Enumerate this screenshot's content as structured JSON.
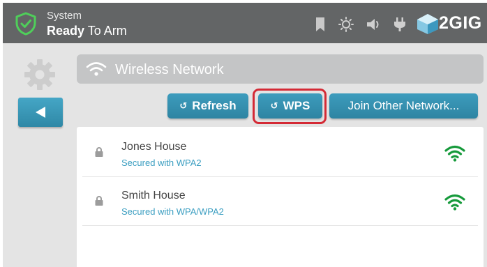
{
  "header": {
    "status_label": "System",
    "status_value_bold": "Ready",
    "status_value_rest": " To Arm",
    "brand": "2GIG",
    "icons": [
      "shield-check-icon",
      "bookmark-icon",
      "brightness-icon",
      "volume-icon",
      "power-plug-icon",
      "2gig-logo-icon"
    ]
  },
  "sidebar": {
    "icons": [
      "gear-icon",
      "back-arrow-icon"
    ]
  },
  "page": {
    "title": "Wireless Network",
    "title_icon": "wifi-icon"
  },
  "actions": {
    "refresh_label": "Refresh",
    "wps_label": "WPS",
    "join_label": "Join Other Network...",
    "button_glyph": "↺",
    "highlighted": "WPS"
  },
  "networks": [
    {
      "name": "Jones House",
      "security": "Secured with WPA2",
      "icon": "lock-icon",
      "signal_icon": "wifi-signal-full-icon"
    },
    {
      "name": "Smith House",
      "security": "Secured with WPA/WPA2",
      "icon": "lock-icon",
      "signal_icon": "wifi-signal-full-icon"
    }
  ],
  "colors": {
    "header_bg": "#636566",
    "accent_button": "#3592b2",
    "highlight": "#d42a35",
    "signal_green": "#169a3b",
    "security_text": "#3b9ec1",
    "shield_green": "#4fcf5a"
  }
}
